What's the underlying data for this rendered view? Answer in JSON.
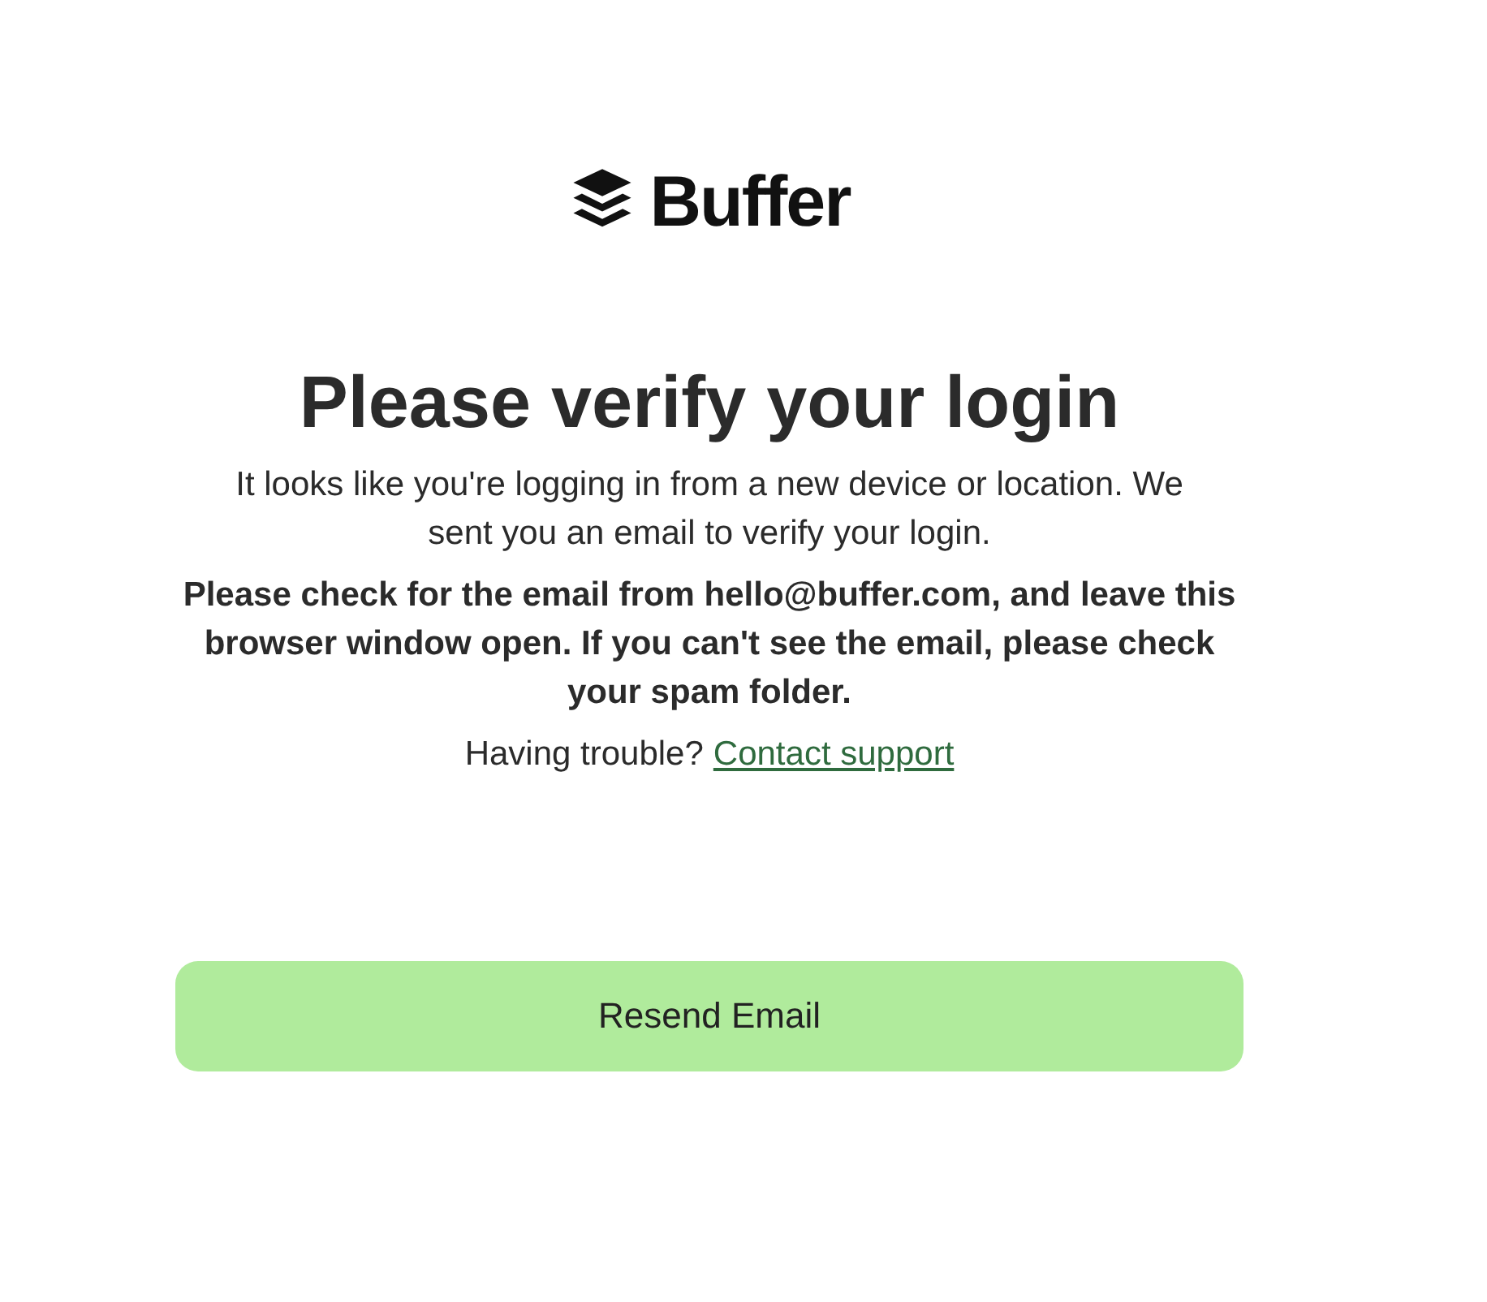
{
  "logo": {
    "text": "Buffer"
  },
  "heading": "Please verify your login",
  "intro": "It looks like you're logging in from a new device or location. We sent you an email to verify your login.",
  "notice": "Please check for the email from hello@buffer.com, and leave this browser window open. If you can't see the email, please check your spam folder.",
  "help": {
    "text": "Having trouble?",
    "link": "Contact support"
  },
  "button": "Resend Email"
}
